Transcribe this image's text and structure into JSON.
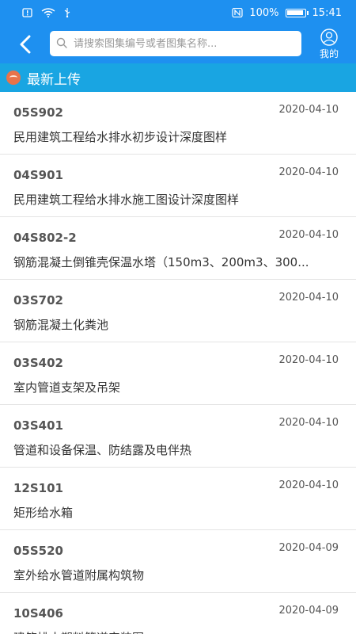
{
  "status_bar": {
    "battery": "100%",
    "battery_level": 1.0,
    "time": "15:41",
    "icons": [
      "alert-icon",
      "wifi-icon",
      "usb-icon",
      "nfc-icon",
      "battery-icon"
    ]
  },
  "header": {
    "search_placeholder": "请搜索图集编号或者图集名称...",
    "me_label": "我的"
  },
  "section": {
    "title": "最新上传"
  },
  "colors": {
    "header_bg": "#1E90F0",
    "section_bg": "#19A5E2",
    "section_icon": "#E8734A"
  },
  "items": [
    {
      "code": "05S902",
      "date": "2020-04-10",
      "name": "民用建筑工程给水排水初步设计深度图样"
    },
    {
      "code": "04S901",
      "date": "2020-04-10",
      "name": "民用建筑工程给水排水施工图设计深度图样"
    },
    {
      "code": "04S802-2",
      "date": "2020-04-10",
      "name": "钢筋混凝土倒锥壳保温水塔（150m3、200m3、300..."
    },
    {
      "code": "03S702",
      "date": "2020-04-10",
      "name": "钢筋混凝土化粪池"
    },
    {
      "code": "03S402",
      "date": "2020-04-10",
      "name": "室内管道支架及吊架"
    },
    {
      "code": "03S401",
      "date": "2020-04-10",
      "name": "管道和设备保温、防结露及电伴热"
    },
    {
      "code": "12S101",
      "date": "2020-04-10",
      "name": "矩形给水箱"
    },
    {
      "code": "05S520",
      "date": "2020-04-09",
      "name": "室外给水管道附属构筑物"
    },
    {
      "code": "10S406",
      "date": "2020-04-09",
      "name": "建筑排水塑料管道安装图"
    }
  ]
}
